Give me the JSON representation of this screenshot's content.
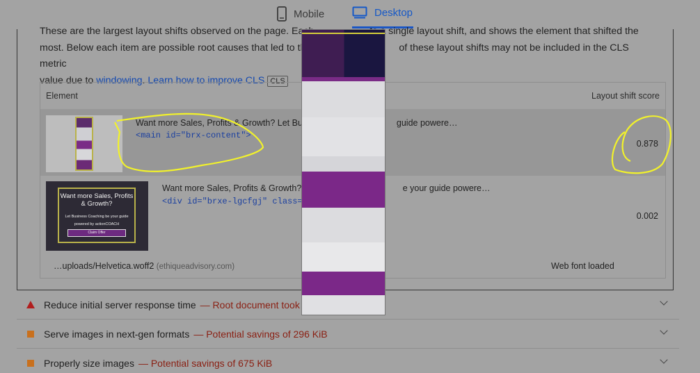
{
  "toggle": {
    "mobile_label": "Mobile",
    "desktop_label": "Desktop",
    "active": "Desktop",
    "accent": "#1a56c5"
  },
  "description": {
    "line1": "These are the largest layout shifts observed on the page. Each",
    "line1_end": "ts a single layout shift, and shows the element that shifted the",
    "line2": "most. Below each item are possible root causes that led to the",
    "line2_end": "of these layout shifts may not be included in the CLS metric",
    "line3": "value due to",
    "windowing_link": "windowing",
    "learn_link": "Learn how to improve CLS",
    "badge": "CLS"
  },
  "table": {
    "col_element": "Element",
    "col_score": "Layout shift score",
    "rows": [
      {
        "text": "Want more Sales, Profits & Growth? Let Busin",
        "text_end": "guide powere…",
        "code": "<main id=\"brx-content\">",
        "score": "0.878"
      },
      {
        "text": "Want more Sales, Profits & Growth? Le",
        "text_end": "e your guide powere…",
        "code": "<div id=\"brxe-lgcfgj\" class=\"br",
        "score": "0.002",
        "thumb_title": "Want more Sales, Profits & Growth?",
        "thumb_sub": "Let Business Coaching be your guide powered by actionCOACH",
        "thumb_cta": "Claim Offer"
      }
    ],
    "root_cause": {
      "url": "…uploads/Helvetica.woff2",
      "domain": "(ethiqueadvisory.com)",
      "cause": "Web font loaded"
    }
  },
  "audits": [
    {
      "title": "Reduce initial server response time",
      "savings": "— Root document took",
      "icon": "warning-triangle-icon",
      "color": "#b11e1e"
    },
    {
      "title": "Serve images in next-gen formats",
      "savings": "— Potential savings of 296 KiB",
      "icon": "orange-square-icon",
      "color": "#c9701d"
    },
    {
      "title": "Properly size images",
      "savings": "— Potential savings of 675 KiB",
      "icon": "orange-square-icon",
      "color": "#c9701d"
    }
  ],
  "annotation_color": "#f2f22a"
}
